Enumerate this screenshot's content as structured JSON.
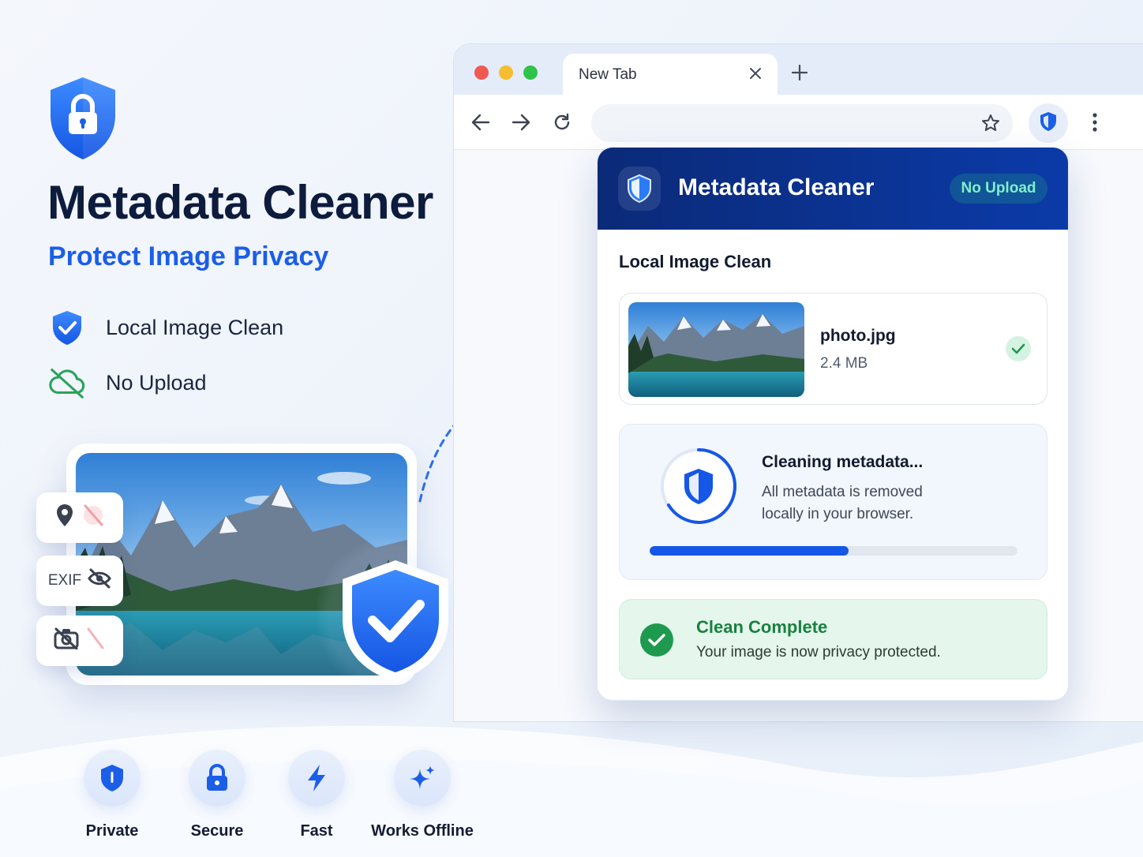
{
  "hero": {
    "title": "Metadata Cleaner",
    "subtitle": "Protect Image Privacy",
    "features": [
      {
        "label": "Local Image Clean",
        "icon": "shield-check-icon"
      },
      {
        "label": "No Upload",
        "icon": "cloud-off-icon"
      }
    ]
  },
  "chips": {
    "exif_label": "EXIF"
  },
  "browser": {
    "tab_title": "New Tab"
  },
  "popup": {
    "title": "Metadata Cleaner",
    "badge": "No Upload",
    "section_title": "Local Image Clean",
    "file": {
      "name": "photo.jpg",
      "size": "2.4 MB"
    },
    "progress": {
      "title": "Cleaning metadata...",
      "line1": "All metadata is removed",
      "line2": "locally in your browser.",
      "value": 0.54
    },
    "complete": {
      "title": "Clean Complete",
      "desc": "Your image is now privacy protected."
    }
  },
  "bottom_features": [
    {
      "label": "Private",
      "icon": "shield-icon"
    },
    {
      "label": "Secure",
      "icon": "lock-icon"
    },
    {
      "label": "Fast",
      "icon": "lightning-icon"
    },
    {
      "label": "Works Offline",
      "icon": "sparkle-icon"
    }
  ],
  "colors": {
    "brand_blue": "#1b5ee8",
    "header_navy": "#0b2a78",
    "success_green": "#1e9a4e"
  }
}
